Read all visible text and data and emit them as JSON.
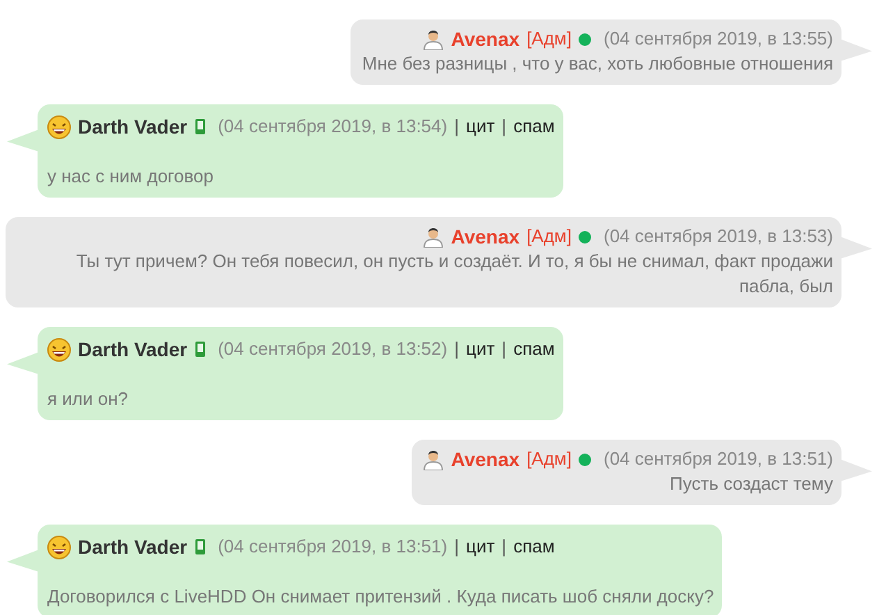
{
  "separator": "|",
  "messages": [
    {
      "kind": "outgoing",
      "author": "Avenax",
      "role": "[Адм]",
      "online": true,
      "mobile": false,
      "date": "(04 сентября 2019, в 13:55)",
      "text": "Мне без разницы , что у вас, хоть любовные отношения"
    },
    {
      "kind": "incoming",
      "author": "Darth Vader",
      "online": false,
      "mobile": true,
      "date": "(04 сентября 2019, в 13:54)",
      "text": "у нас с ним договор",
      "actions": [
        "цит",
        "спам"
      ]
    },
    {
      "kind": "outgoing",
      "author": "Avenax",
      "role": "[Адм]",
      "online": true,
      "mobile": false,
      "date": "(04 сентября 2019, в 13:53)",
      "text": "Ты тут причем? Он тебя повесил, он пусть и создаёт. И то, я бы не снимал, факт продажи пабла, был"
    },
    {
      "kind": "incoming",
      "author": "Darth Vader",
      "online": false,
      "mobile": true,
      "date": "(04 сентября 2019, в 13:52)",
      "text": "я или он?",
      "actions": [
        "цит",
        "спам"
      ]
    },
    {
      "kind": "outgoing",
      "author": "Avenax",
      "role": "[Адм]",
      "online": true,
      "mobile": false,
      "date": "(04 сентября 2019, в 13:51)",
      "text": "Пусть создаст тему"
    },
    {
      "kind": "incoming",
      "author": "Darth Vader",
      "online": false,
      "mobile": true,
      "date": "(04 сентября 2019, в 13:51)",
      "text": "Договорился с LiveHDD Он снимает притензий . Куда писать шоб сняли доску?",
      "actions": [
        "цит",
        "спам"
      ]
    }
  ]
}
